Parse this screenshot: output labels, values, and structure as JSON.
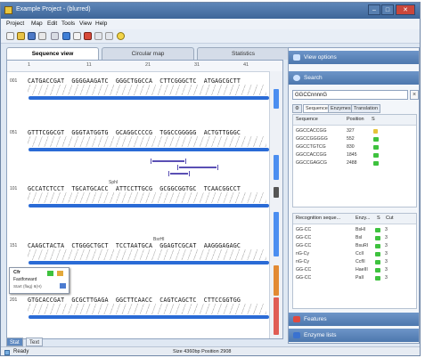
{
  "window": {
    "title": "Example Project - (blurred)"
  },
  "menu": [
    "Project",
    "Map",
    "Edit",
    "Tools",
    "View",
    "Help"
  ],
  "tabs": [
    {
      "label": "Sequence view",
      "active": true
    },
    {
      "label": "Circular map",
      "active": false
    },
    {
      "label": "Statistics",
      "active": false
    }
  ],
  "ruler": [
    "1",
    "11",
    "21",
    "31",
    "41"
  ],
  "sequence": [
    {
      "pos": "001",
      "seq": "CATGACCGAT  GGGGAAGATC  GGGCTGGCCA  CTTCGGGCTC  ATGAGCGCTT"
    },
    {
      "pos": "051",
      "seq": "GTTTCGGCGT  GGGTATGGTG  GCAGGCCCCG  TGGCCGGGGG  ACTGTTGGGC"
    },
    {
      "pos": "101",
      "seq": "GCCATCTCCT  TGCATGCACC  ATTCCTTGCG  GCGGCGGTGC  TCAACGGCCT"
    },
    {
      "pos": "151",
      "seq": "CAAGCTACTA  CTGGGCTGCT  TCCTAATGCA  GGAGTCGCAT  AAGGGAGAGC"
    },
    {
      "pos": "201",
      "seq": "GTGCACCGAT  GCGCTTGAGA  GGCTTCAACC  CAGTCAGCTC  CTTCCGGTGG"
    }
  ],
  "enzyme_labels": [
    "SphI",
    "BsrHI"
  ],
  "tooltip": {
    "title": "Cfr",
    "subtitle": "Fastforward",
    "detail": "Start (flag) 6(H)"
  },
  "bottom_tabs": [
    {
      "label": "Stat",
      "active": true
    },
    {
      "label": "Text",
      "active": false
    }
  ],
  "status": {
    "ready": "Ready",
    "info": "Size 4360bp  Position 2908"
  },
  "side": {
    "view_options": "View options",
    "search": "Search",
    "search_value": "GGCCnnnnG",
    "clear": "×",
    "tabs": [
      "Sequence",
      "Enzymes",
      "Translation"
    ],
    "results_headers": [
      "Sequence",
      "Position",
      "S"
    ],
    "results": [
      {
        "seq": "GGCCACCGG",
        "pos": "327",
        "mark": "yellow"
      },
      {
        "seq": "GGCCGGGGG",
        "pos": "552",
        "mark": "green"
      },
      {
        "seq": "GGCCTGTCG",
        "pos": "830",
        "mark": "green"
      },
      {
        "seq": "GGCCACCGG",
        "pos": "1845",
        "mark": "green"
      },
      {
        "seq": "GGCCGAGCG",
        "pos": "2488",
        "mark": "green"
      }
    ],
    "recog_headers": [
      "Recognition seque...",
      "Enzy...",
      "S",
      "Cut"
    ],
    "recog": [
      {
        "seq": "GG-CC",
        "enzyme": "BsHI",
        "cut": "3"
      },
      {
        "seq": "GG-CC",
        "enzyme": "BsI",
        "cut": "3"
      },
      {
        "seq": "GG-CC",
        "enzyme": "BsuRI",
        "cut": "3"
      },
      {
        "seq": "nG-Cy",
        "enzyme": "CcII",
        "cut": "3"
      },
      {
        "seq": "nG-Cy",
        "enzyme": "CcfII",
        "cut": "3"
      },
      {
        "seq": "GG-CC",
        "enzyme": "HaeIII",
        "cut": "3"
      },
      {
        "seq": "GG-CC",
        "enzyme": "PaII",
        "cut": "3"
      }
    ],
    "features": "Features",
    "enzyme_lists": "Enzyme lists"
  }
}
